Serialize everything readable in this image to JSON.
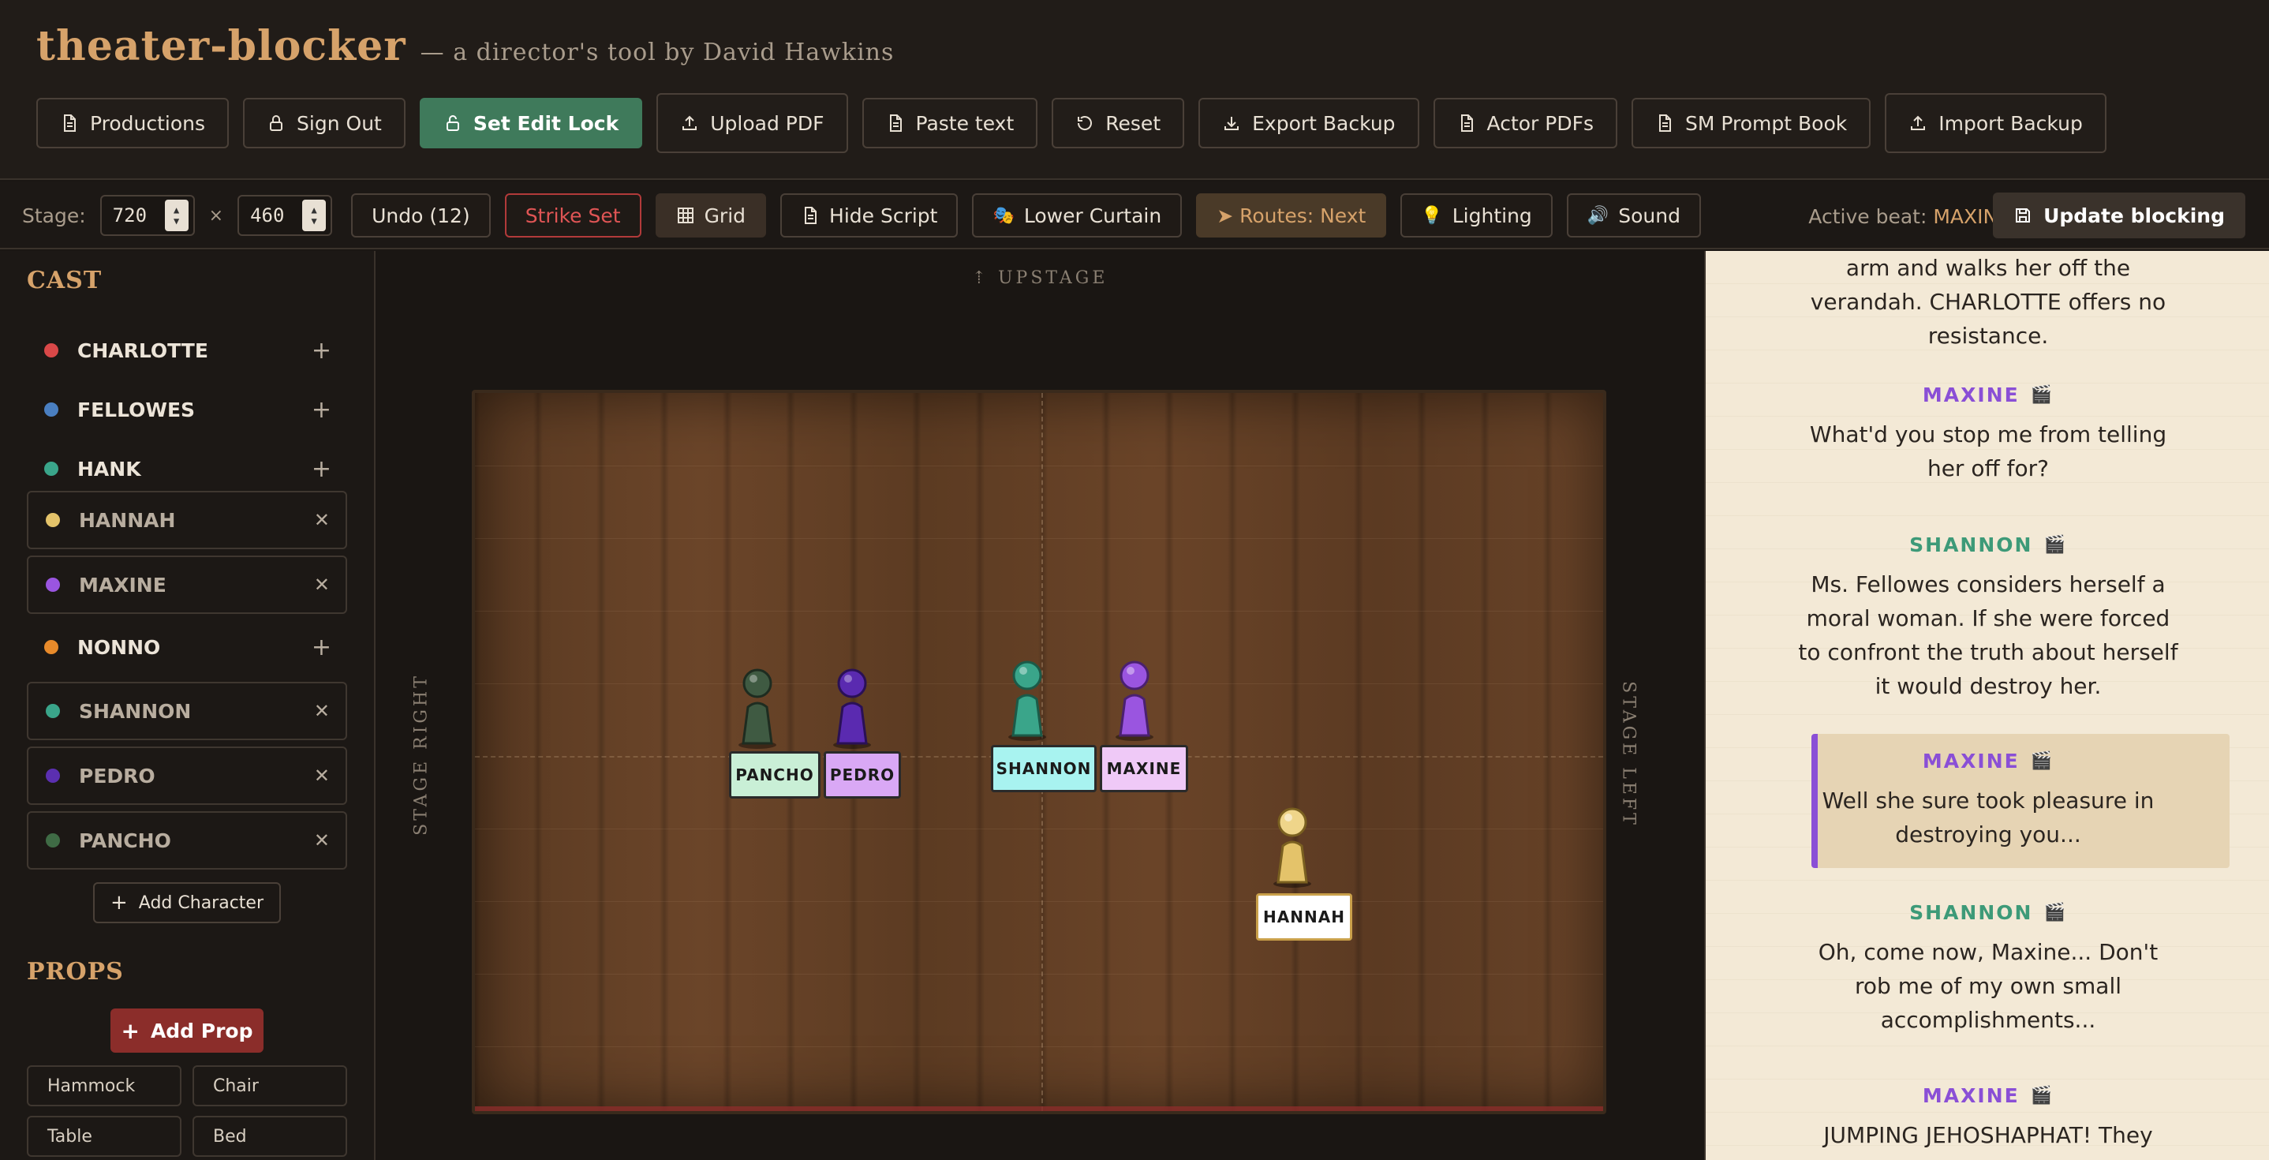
{
  "header": {
    "title": "theater-blocker",
    "subtitle": "— a director's tool by David Hawkins",
    "buttons": [
      {
        "label": "Productions",
        "icon": "document-icon"
      },
      {
        "label": "Sign Out",
        "icon": "lock-icon"
      },
      {
        "label": "Set Edit Lock",
        "icon": "unlock-icon"
      },
      {
        "label": "Upload PDF",
        "icon": "upload-icon"
      },
      {
        "label": "Paste text",
        "icon": "document-icon"
      },
      {
        "label": "Reset",
        "icon": "reset-icon"
      },
      {
        "label": "Export Backup",
        "icon": "download-icon"
      },
      {
        "label": "Actor PDFs",
        "icon": "document-icon"
      },
      {
        "label": "SM Prompt Book",
        "icon": "document-icon"
      },
      {
        "label": "Import Backup",
        "icon": "upload-icon"
      }
    ]
  },
  "toolbar": {
    "stage_label": "Stage:",
    "width": "720",
    "times": "×",
    "height": "460",
    "undo": "Undo (12)",
    "strike_set": "Strike Set",
    "grid": "Grid",
    "hide_script": "Hide Script",
    "lower_curtain": "Lower Curtain",
    "routes": "➤ Routes: Next",
    "lighting": "Lighting",
    "sound": "Sound",
    "active_beat_label": "Active beat:",
    "active_beat_value": "MAXINE",
    "update_blocking": "Update blocking"
  },
  "cast": {
    "title": "CAST",
    "items": [
      {
        "name": "CHARLOTTE",
        "color": "#d94848",
        "action": "+",
        "placed": false
      },
      {
        "name": "FELLOWES",
        "color": "#4a7fc1",
        "action": "+",
        "placed": false
      },
      {
        "name": "HANK",
        "color": "#3aa58a",
        "action": "+",
        "placed": false
      },
      {
        "name": "HANNAH",
        "color": "#e4c36a",
        "action": "✕",
        "placed": true
      },
      {
        "name": "MAXINE",
        "color": "#9a55e0",
        "action": "✕",
        "placed": true
      },
      {
        "name": "NONNO",
        "color": "#e88a2a",
        "action": "+",
        "placed": false
      },
      {
        "name": "SHANNON",
        "color": "#3aa58a",
        "action": "✕",
        "placed": true
      },
      {
        "name": "PEDRO",
        "color": "#5b2fb0",
        "action": "✕",
        "placed": true
      },
      {
        "name": "PANCHO",
        "color": "#3f6b45",
        "action": "✕",
        "placed": true
      }
    ],
    "add_character": "Add Character"
  },
  "props": {
    "title": "PROPS",
    "add_prop": "Add Prop",
    "items": [
      "Hammock",
      "Chair",
      "Table",
      "Bed"
    ]
  },
  "stage": {
    "upstage": "⇡ UPSTAGE",
    "stage_right": "STAGE RIGHT",
    "stage_left": "STAGE LEFT",
    "actors": [
      {
        "name": "PANCHO",
        "body": "#3f5a42",
        "label_bg": "#c9efd6"
      },
      {
        "name": "PEDRO",
        "body": "#5a2ab0",
        "label_bg": "#d9a8f5"
      },
      {
        "name": "SHANNON",
        "body": "#3aa58a",
        "label_bg": "#a8f3f0"
      },
      {
        "name": "MAXINE",
        "body": "#9a55e0",
        "label_bg": "#efc9f7"
      },
      {
        "name": "HANNAH",
        "body": "#e4c36a",
        "label_bg": "#ffffff"
      }
    ]
  },
  "script": {
    "lines": [
      {
        "speaker": "",
        "text": "arm and walks her off the verandah. CHARLOTTE offers no resistance."
      },
      {
        "speaker": "MAXINE",
        "text": "What'd you stop me from telling her off for?"
      },
      {
        "speaker": "SHANNON",
        "text": "Ms. Fellowes considers herself a moral woman. If she were forced to confront the truth about herself it would destroy her."
      },
      {
        "speaker": "MAXINE",
        "text": "Well she sure took pleasure in destroying you..."
      },
      {
        "speaker": "SHANNON",
        "text": "Oh, come now, Maxine... Don't rob me of my own small accomplishments..."
      },
      {
        "speaker": "MAXINE",
        "text": "JUMPING JEHOSHAPHAT! They"
      }
    ]
  }
}
